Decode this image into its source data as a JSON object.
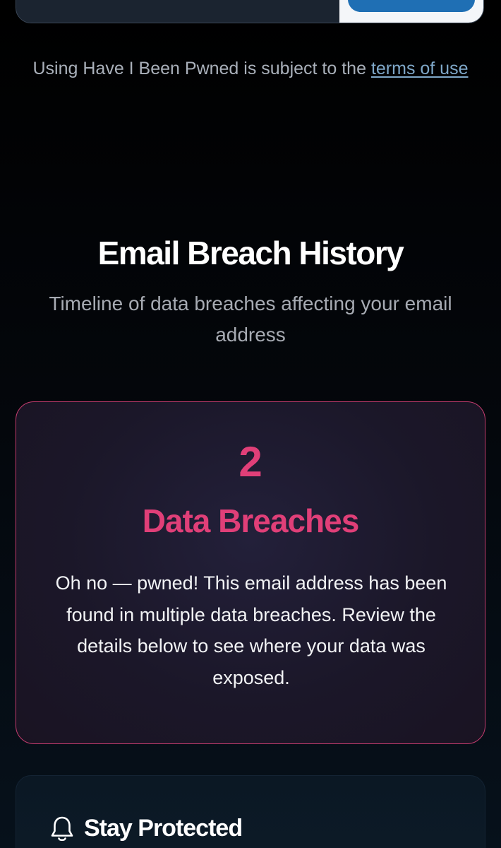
{
  "search": {
    "placeholder": "",
    "button_label": ""
  },
  "terms": {
    "text": "Using Have I Been Pwned is subject to the ",
    "link": "terms of use"
  },
  "history": {
    "title": "Email Breach History",
    "subtitle": "Timeline of data breaches affecting your email address"
  },
  "breach_summary": {
    "count": "2",
    "label": "Data Breaches",
    "message": "Oh no — pwned! This email address has been found in multiple data breaches. Review the details below to see where your data was exposed."
  },
  "protect": {
    "icon": "bell-icon",
    "title": "Stay Protected"
  },
  "colors": {
    "accent_pink": "#e03f78",
    "link_blue": "#7fa8c9",
    "button_blue": "#1f6fb4"
  }
}
